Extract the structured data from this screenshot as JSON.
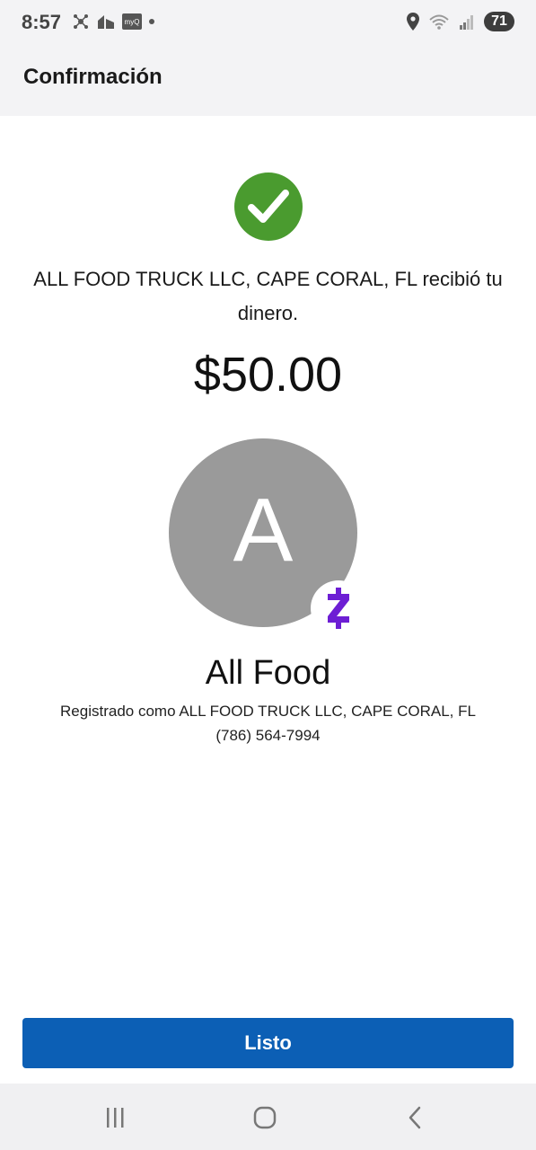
{
  "status_bar": {
    "time": "8:57",
    "myq_label": "myQ",
    "battery": "71"
  },
  "header": {
    "title": "Confirmación"
  },
  "confirmation": {
    "message": "ALL FOOD TRUCK LLC, CAPE CORAL, FL recibió tu dinero.",
    "amount": "$50.00"
  },
  "recipient": {
    "avatar_letter": "A",
    "name": "All Food",
    "registered_as": "Registrado como ALL FOOD TRUCK LLC, CAPE CORAL, FL",
    "phone": "(786) 564-7994"
  },
  "actions": {
    "done_label": "Listo"
  },
  "colors": {
    "success_green": "#4a9b2f",
    "primary_blue": "#0c5fb5",
    "zelle_purple": "#6d1ed4",
    "avatar_gray": "#9a9a9a"
  },
  "icons": {
    "success": "check-icon",
    "zelle": "zelle-logo-icon",
    "nav_recents": "recents-icon",
    "nav_home": "home-icon",
    "nav_back": "back-icon"
  }
}
